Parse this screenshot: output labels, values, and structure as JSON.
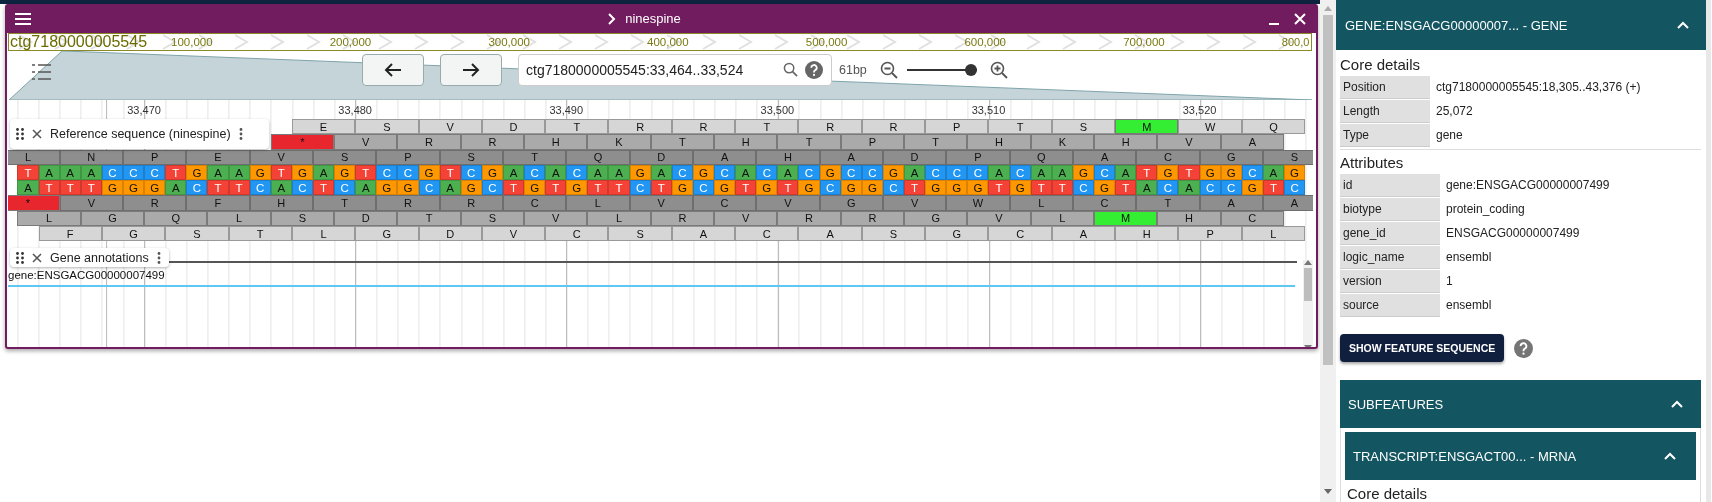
{
  "window": {
    "title": "ninespine"
  },
  "overview": {
    "ref_name": "ctg7180000005545",
    "ticks": [
      "100,000",
      "200,000",
      "300,000",
      "400,000",
      "500,000",
      "600,000",
      "700,000",
      "800,0"
    ]
  },
  "navigation": {
    "location": "ctg7180000005545:33,464..33,524",
    "span": "61bp",
    "zoom_slider": {
      "level": 0.92
    }
  },
  "ruler": {
    "ticks": [
      "33,470",
      "33,480",
      "33,490",
      "33,500",
      "33,510",
      "33,520"
    ]
  },
  "reference_track": {
    "label": "Reference sequence (ninespine)",
    "forward_frames": [
      [
        {
          "aa": "E",
          "kind": "codon"
        },
        {
          "aa": "S",
          "kind": "codon"
        },
        {
          "aa": "V",
          "kind": "codon"
        },
        {
          "aa": "D",
          "kind": "codon"
        },
        {
          "aa": "T",
          "kind": "codon"
        },
        {
          "aa": "R",
          "kind": "codon"
        },
        {
          "aa": "R",
          "kind": "codon"
        },
        {
          "aa": "T",
          "kind": "codon"
        },
        {
          "aa": "R",
          "kind": "codon"
        },
        {
          "aa": "R",
          "kind": "codon"
        },
        {
          "aa": "P",
          "kind": "codon"
        },
        {
          "aa": "T",
          "kind": "codon"
        },
        {
          "aa": "S",
          "kind": "codon"
        },
        {
          "aa": "M",
          "kind": "start"
        },
        {
          "aa": "W",
          "kind": "codon"
        },
        {
          "aa": "Q",
          "kind": "codon"
        }
      ],
      [
        {
          "aa": "*",
          "kind": "stop"
        },
        {
          "aa": "V",
          "kind": "codon"
        },
        {
          "aa": "R",
          "kind": "codon"
        },
        {
          "aa": "R",
          "kind": "codon"
        },
        {
          "aa": "H",
          "kind": "codon"
        },
        {
          "aa": "K",
          "kind": "codon"
        },
        {
          "aa": "T",
          "kind": "codon"
        },
        {
          "aa": "H",
          "kind": "codon"
        },
        {
          "aa": "T",
          "kind": "codon"
        },
        {
          "aa": "P",
          "kind": "codon"
        },
        {
          "aa": "T",
          "kind": "codon"
        },
        {
          "aa": "H",
          "kind": "codon"
        },
        {
          "aa": "K",
          "kind": "codon"
        },
        {
          "aa": "H",
          "kind": "codon"
        },
        {
          "aa": "V",
          "kind": "codon"
        },
        {
          "aa": "A",
          "kind": "codon"
        }
      ],
      [
        {
          "aa": "L",
          "kind": "codon"
        },
        {
          "aa": "N",
          "kind": "codon"
        },
        {
          "aa": "P",
          "kind": "codon"
        },
        {
          "aa": "E",
          "kind": "codon"
        },
        {
          "aa": "V",
          "kind": "codon"
        },
        {
          "aa": "S",
          "kind": "codon"
        },
        {
          "aa": "P",
          "kind": "codon"
        },
        {
          "aa": "S",
          "kind": "codon"
        },
        {
          "aa": "T",
          "kind": "codon"
        },
        {
          "aa": "Q",
          "kind": "codon"
        },
        {
          "aa": "D",
          "kind": "codon"
        },
        {
          "aa": "A",
          "kind": "codon"
        },
        {
          "aa": "H",
          "kind": "codon"
        },
        {
          "aa": "A",
          "kind": "codon"
        },
        {
          "aa": "D",
          "kind": "codon"
        },
        {
          "aa": "P",
          "kind": "codon"
        },
        {
          "aa": "Q",
          "kind": "codon"
        },
        {
          "aa": "A",
          "kind": "codon"
        },
        {
          "aa": "C",
          "kind": "codon"
        },
        {
          "aa": "G",
          "kind": "codon"
        },
        {
          "aa": "S",
          "kind": "codon"
        }
      ]
    ],
    "forward_strand": [
      {
        "base": "T",
        "color": "#f44336"
      },
      {
        "base": "A",
        "color": "#4caf50"
      },
      {
        "base": "A",
        "color": "#4caf50"
      },
      {
        "base": "A",
        "color": "#4caf50"
      },
      {
        "base": "C",
        "color": "#2196f3"
      },
      {
        "base": "C",
        "color": "#2196f3"
      },
      {
        "base": "C",
        "color": "#2196f3"
      },
      {
        "base": "T",
        "color": "#f44336"
      },
      {
        "base": "G",
        "color": "#ff9800"
      },
      {
        "base": "A",
        "color": "#4caf50"
      },
      {
        "base": "A",
        "color": "#4caf50"
      },
      {
        "base": "G",
        "color": "#ff9800"
      },
      {
        "base": "T",
        "color": "#f44336"
      },
      {
        "base": "G",
        "color": "#ff9800"
      },
      {
        "base": "A",
        "color": "#4caf50"
      },
      {
        "base": "G",
        "color": "#ff9800"
      },
      {
        "base": "T",
        "color": "#f44336"
      },
      {
        "base": "C",
        "color": "#2196f3"
      },
      {
        "base": "C",
        "color": "#2196f3"
      },
      {
        "base": "G",
        "color": "#ff9800"
      },
      {
        "base": "T",
        "color": "#f44336"
      },
      {
        "base": "C",
        "color": "#2196f3"
      },
      {
        "base": "G",
        "color": "#ff9800"
      },
      {
        "base": "A",
        "color": "#4caf50"
      },
      {
        "base": "C",
        "color": "#2196f3"
      },
      {
        "base": "A",
        "color": "#4caf50"
      },
      {
        "base": "C",
        "color": "#2196f3"
      },
      {
        "base": "A",
        "color": "#4caf50"
      },
      {
        "base": "A",
        "color": "#4caf50"
      },
      {
        "base": "G",
        "color": "#ff9800"
      },
      {
        "base": "A",
        "color": "#4caf50"
      },
      {
        "base": "C",
        "color": "#2196f3"
      },
      {
        "base": "G",
        "color": "#ff9800"
      },
      {
        "base": "C",
        "color": "#2196f3"
      },
      {
        "base": "A",
        "color": "#4caf50"
      },
      {
        "base": "C",
        "color": "#2196f3"
      },
      {
        "base": "A",
        "color": "#4caf50"
      },
      {
        "base": "C",
        "color": "#2196f3"
      },
      {
        "base": "G",
        "color": "#ff9800"
      },
      {
        "base": "C",
        "color": "#2196f3"
      },
      {
        "base": "C",
        "color": "#2196f3"
      },
      {
        "base": "G",
        "color": "#ff9800"
      },
      {
        "base": "A",
        "color": "#4caf50"
      },
      {
        "base": "C",
        "color": "#2196f3"
      },
      {
        "base": "C",
        "color": "#2196f3"
      },
      {
        "base": "C",
        "color": "#2196f3"
      },
      {
        "base": "A",
        "color": "#4caf50"
      },
      {
        "base": "C",
        "color": "#2196f3"
      },
      {
        "base": "A",
        "color": "#4caf50"
      },
      {
        "base": "A",
        "color": "#4caf50"
      },
      {
        "base": "G",
        "color": "#ff9800"
      },
      {
        "base": "C",
        "color": "#2196f3"
      },
      {
        "base": "A",
        "color": "#4caf50"
      },
      {
        "base": "T",
        "color": "#f44336"
      },
      {
        "base": "G",
        "color": "#ff9800"
      },
      {
        "base": "T",
        "color": "#f44336"
      },
      {
        "base": "G",
        "color": "#ff9800"
      },
      {
        "base": "G",
        "color": "#ff9800"
      },
      {
        "base": "C",
        "color": "#2196f3"
      },
      {
        "base": "A",
        "color": "#4caf50"
      },
      {
        "base": "G",
        "color": "#ff9800"
      }
    ],
    "reverse_strand": [
      {
        "base": "A",
        "color": "#4caf50"
      },
      {
        "base": "T",
        "color": "#f44336"
      },
      {
        "base": "T",
        "color": "#f44336"
      },
      {
        "base": "T",
        "color": "#f44336"
      },
      {
        "base": "G",
        "color": "#ff9800"
      },
      {
        "base": "G",
        "color": "#ff9800"
      },
      {
        "base": "G",
        "color": "#ff9800"
      },
      {
        "base": "A",
        "color": "#4caf50"
      },
      {
        "base": "C",
        "color": "#2196f3"
      },
      {
        "base": "T",
        "color": "#f44336"
      },
      {
        "base": "T",
        "color": "#f44336"
      },
      {
        "base": "C",
        "color": "#2196f3"
      },
      {
        "base": "A",
        "color": "#4caf50"
      },
      {
        "base": "C",
        "color": "#2196f3"
      },
      {
        "base": "T",
        "color": "#f44336"
      },
      {
        "base": "C",
        "color": "#2196f3"
      },
      {
        "base": "A",
        "color": "#4caf50"
      },
      {
        "base": "G",
        "color": "#ff9800"
      },
      {
        "base": "G",
        "color": "#ff9800"
      },
      {
        "base": "C",
        "color": "#2196f3"
      },
      {
        "base": "A",
        "color": "#4caf50"
      },
      {
        "base": "G",
        "color": "#ff9800"
      },
      {
        "base": "C",
        "color": "#2196f3"
      },
      {
        "base": "T",
        "color": "#f44336"
      },
      {
        "base": "G",
        "color": "#ff9800"
      },
      {
        "base": "T",
        "color": "#f44336"
      },
      {
        "base": "G",
        "color": "#ff9800"
      },
      {
        "base": "T",
        "color": "#f44336"
      },
      {
        "base": "T",
        "color": "#f44336"
      },
      {
        "base": "C",
        "color": "#2196f3"
      },
      {
        "base": "T",
        "color": "#f44336"
      },
      {
        "base": "G",
        "color": "#ff9800"
      },
      {
        "base": "C",
        "color": "#2196f3"
      },
      {
        "base": "G",
        "color": "#ff9800"
      },
      {
        "base": "T",
        "color": "#f44336"
      },
      {
        "base": "G",
        "color": "#ff9800"
      },
      {
        "base": "T",
        "color": "#f44336"
      },
      {
        "base": "G",
        "color": "#ff9800"
      },
      {
        "base": "C",
        "color": "#2196f3"
      },
      {
        "base": "G",
        "color": "#ff9800"
      },
      {
        "base": "G",
        "color": "#ff9800"
      },
      {
        "base": "C",
        "color": "#2196f3"
      },
      {
        "base": "T",
        "color": "#f44336"
      },
      {
        "base": "G",
        "color": "#ff9800"
      },
      {
        "base": "G",
        "color": "#ff9800"
      },
      {
        "base": "G",
        "color": "#ff9800"
      },
      {
        "base": "T",
        "color": "#f44336"
      },
      {
        "base": "G",
        "color": "#ff9800"
      },
      {
        "base": "T",
        "color": "#f44336"
      },
      {
        "base": "T",
        "color": "#f44336"
      },
      {
        "base": "C",
        "color": "#2196f3"
      },
      {
        "base": "G",
        "color": "#ff9800"
      },
      {
        "base": "T",
        "color": "#f44336"
      },
      {
        "base": "A",
        "color": "#4caf50"
      },
      {
        "base": "C",
        "color": "#2196f3"
      },
      {
        "base": "A",
        "color": "#4caf50"
      },
      {
        "base": "C",
        "color": "#2196f3"
      },
      {
        "base": "C",
        "color": "#2196f3"
      },
      {
        "base": "G",
        "color": "#ff9800"
      },
      {
        "base": "T",
        "color": "#f44336"
      },
      {
        "base": "C",
        "color": "#2196f3"
      }
    ],
    "reverse_frames": [
      [
        {
          "aa": "*",
          "kind": "stop"
        },
        {
          "aa": "V",
          "kind": "codon"
        },
        {
          "aa": "R",
          "kind": "codon"
        },
        {
          "aa": "F",
          "kind": "codon"
        },
        {
          "aa": "H",
          "kind": "codon"
        },
        {
          "aa": "T",
          "kind": "codon"
        },
        {
          "aa": "R",
          "kind": "codon"
        },
        {
          "aa": "R",
          "kind": "codon"
        },
        {
          "aa": "C",
          "kind": "codon"
        },
        {
          "aa": "L",
          "kind": "codon"
        },
        {
          "aa": "V",
          "kind": "codon"
        },
        {
          "aa": "C",
          "kind": "codon"
        },
        {
          "aa": "V",
          "kind": "codon"
        },
        {
          "aa": "G",
          "kind": "codon"
        },
        {
          "aa": "V",
          "kind": "codon"
        },
        {
          "aa": "W",
          "kind": "codon"
        },
        {
          "aa": "L",
          "kind": "codon"
        },
        {
          "aa": "C",
          "kind": "codon"
        },
        {
          "aa": "T",
          "kind": "codon"
        },
        {
          "aa": "A",
          "kind": "codon"
        },
        {
          "aa": "A",
          "kind": "codon"
        }
      ],
      [
        {
          "aa": "L",
          "kind": "codon"
        },
        {
          "aa": "G",
          "kind": "codon"
        },
        {
          "aa": "Q",
          "kind": "codon"
        },
        {
          "aa": "L",
          "kind": "codon"
        },
        {
          "aa": "S",
          "kind": "codon"
        },
        {
          "aa": "D",
          "kind": "codon"
        },
        {
          "aa": "T",
          "kind": "codon"
        },
        {
          "aa": "S",
          "kind": "codon"
        },
        {
          "aa": "V",
          "kind": "codon"
        },
        {
          "aa": "L",
          "kind": "codon"
        },
        {
          "aa": "R",
          "kind": "codon"
        },
        {
          "aa": "V",
          "kind": "codon"
        },
        {
          "aa": "R",
          "kind": "codon"
        },
        {
          "aa": "R",
          "kind": "codon"
        },
        {
          "aa": "G",
          "kind": "codon"
        },
        {
          "aa": "V",
          "kind": "codon"
        },
        {
          "aa": "L",
          "kind": "codon"
        },
        {
          "aa": "M",
          "kind": "start"
        },
        {
          "aa": "H",
          "kind": "codon"
        },
        {
          "aa": "C",
          "kind": "codon"
        }
      ],
      [
        {
          "aa": "F",
          "kind": "codon"
        },
        {
          "aa": "G",
          "kind": "codon"
        },
        {
          "aa": "S",
          "kind": "codon"
        },
        {
          "aa": "T",
          "kind": "codon"
        },
        {
          "aa": "L",
          "kind": "codon"
        },
        {
          "aa": "G",
          "kind": "codon"
        },
        {
          "aa": "D",
          "kind": "codon"
        },
        {
          "aa": "V",
          "kind": "codon"
        },
        {
          "aa": "C",
          "kind": "codon"
        },
        {
          "aa": "S",
          "kind": "codon"
        },
        {
          "aa": "A",
          "kind": "codon"
        },
        {
          "aa": "C",
          "kind": "codon"
        },
        {
          "aa": "A",
          "kind": "codon"
        },
        {
          "aa": "S",
          "kind": "codon"
        },
        {
          "aa": "G",
          "kind": "codon"
        },
        {
          "aa": "C",
          "kind": "codon"
        },
        {
          "aa": "A",
          "kind": "codon"
        },
        {
          "aa": "H",
          "kind": "codon"
        },
        {
          "aa": "P",
          "kind": "codon"
        },
        {
          "aa": "L",
          "kind": "codon"
        }
      ]
    ]
  },
  "gene_track": {
    "label": "Gene annotations",
    "feature_label": "gene:ENSGACG00000007499"
  },
  "feature_panel": {
    "header": {
      "title": "GENE:ENSGACG00000007... - GENE",
      "expanded": true
    },
    "core_details": {
      "title": "Core details",
      "rows": [
        {
          "label": "Position",
          "value": "ctg7180000005545:18,305..43,376 (+)"
        },
        {
          "label": "Length",
          "value": "25,072"
        },
        {
          "label": "Type",
          "value": "gene"
        }
      ]
    },
    "attributes": {
      "title": "Attributes",
      "rows": [
        {
          "label": "id",
          "value": "gene:ENSGACG00000007499"
        },
        {
          "label": "biotype",
          "value": "protein_coding"
        },
        {
          "label": "gene_id",
          "value": "ENSGACG00000007499"
        },
        {
          "label": "logic_name",
          "value": "ensembl"
        },
        {
          "label": "version",
          "value": "1"
        },
        {
          "label": "source",
          "value": "ensembl"
        }
      ]
    },
    "sequence_button": "SHOW FEATURE SEQUENCE",
    "subfeatures": {
      "title": "SUBFEATURES",
      "expanded": true,
      "transcript": {
        "title": "TRANSCRIPT:ENSGACT00... - MRNA",
        "expanded": true,
        "section_title": "Core details"
      }
    }
  }
}
